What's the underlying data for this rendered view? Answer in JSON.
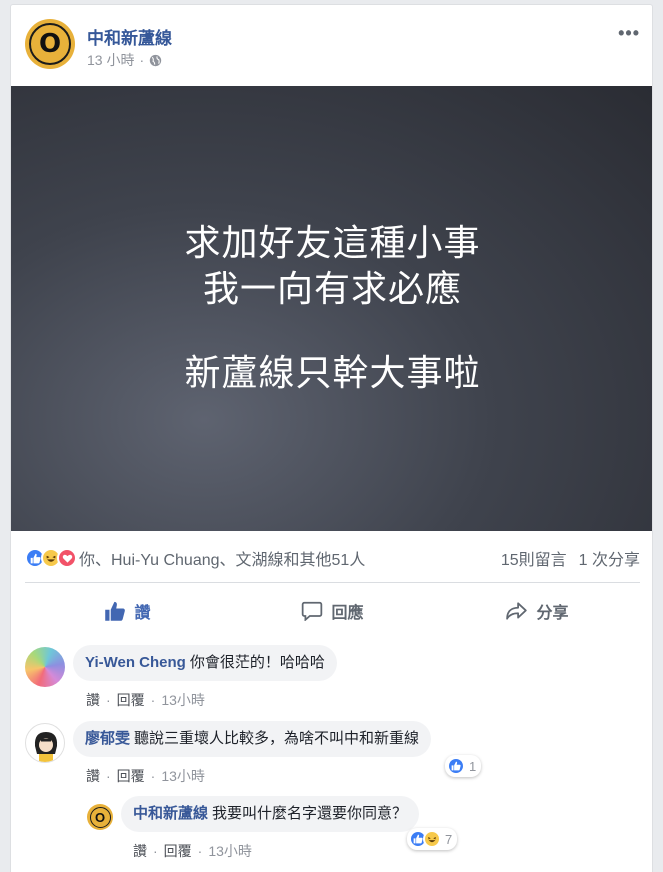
{
  "post": {
    "page_name": "中和新蘆線",
    "avatar_letter": "O",
    "time": "13 小時",
    "meta_sep": "·",
    "more": "•••",
    "image_lines": [
      "求加好友這種小事",
      "我一向有求必應",
      "新蘆線只幹大事啦"
    ]
  },
  "summary": {
    "reactors": "你、Hui-Yu Chuang、文湖線和其他51人",
    "comments": "15則留言",
    "shares": "1 次分享",
    "reaction_icons": [
      "like-icon",
      "haha-icon",
      "love-icon"
    ]
  },
  "actions": {
    "like": "讚",
    "comment": "回應",
    "share": "分享"
  },
  "comments": [
    {
      "author": "Yi-Wen Cheng",
      "text": "你會很茫的！哈哈哈",
      "like": "讚",
      "reply": "回覆",
      "time": "13小時"
    },
    {
      "author": "廖郁雯",
      "text": "聽說三重壞人比較多，為啥不叫中和新重線",
      "like": "讚",
      "reply": "回覆",
      "time": "13小時",
      "reactions": "1"
    },
    {
      "author": "中和新蘆線",
      "text": "我要叫什麼名字還要你同意？",
      "like": "讚",
      "reply": "回覆",
      "time": "13小時",
      "reactions": "7"
    }
  ],
  "colors": {
    "link": "#365899",
    "like_active": "#4267b2",
    "like_reaction": "#3b7df5",
    "haha_reaction": "#f7c94b",
    "love_reaction": "#f25268",
    "page_avatar": "#e8b13a"
  }
}
